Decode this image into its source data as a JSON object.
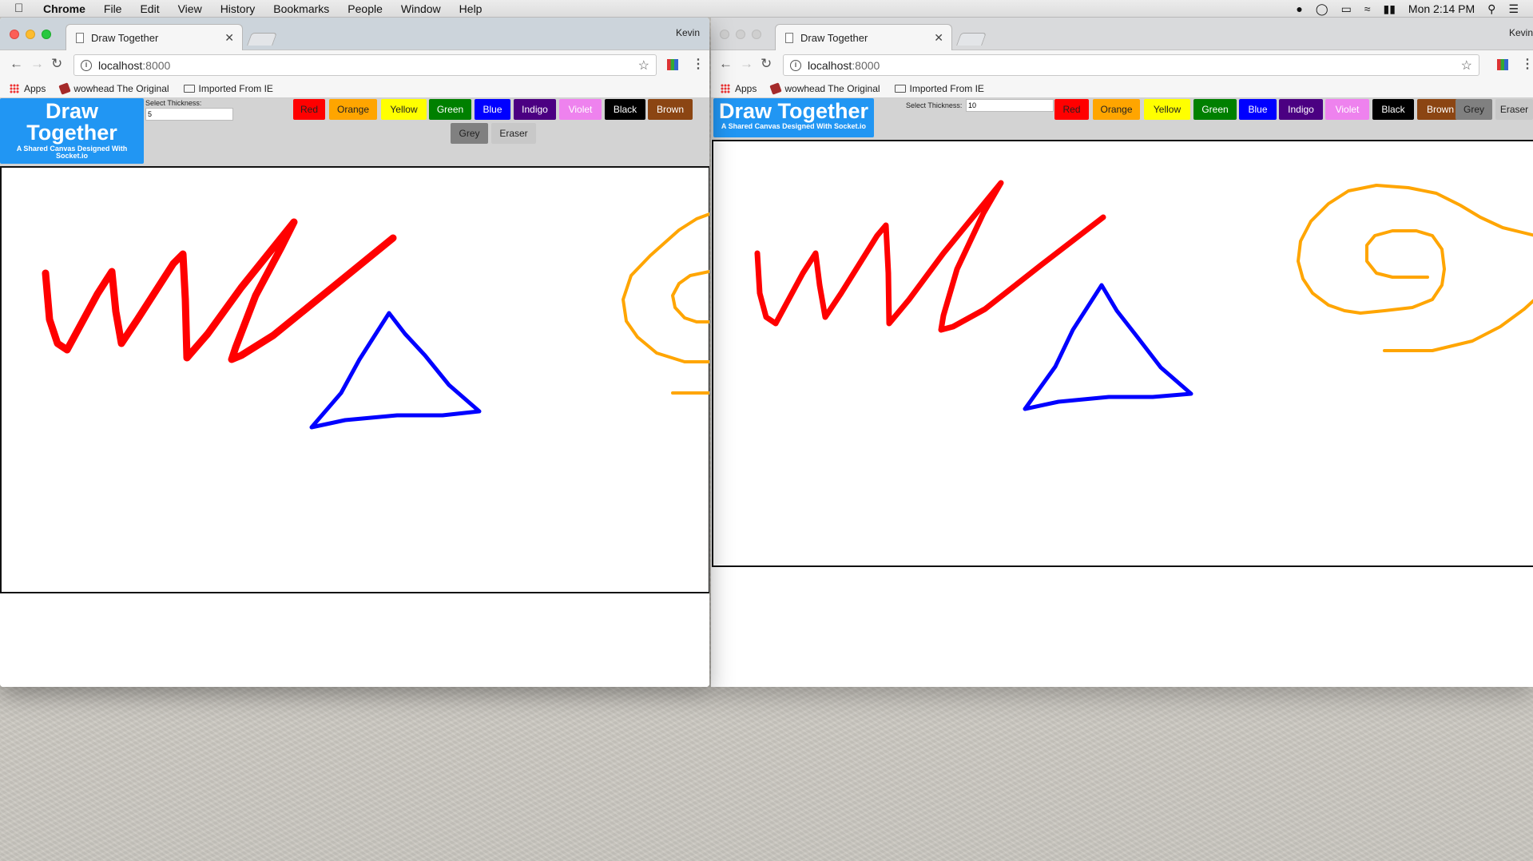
{
  "menubar": {
    "app": "Chrome",
    "items": [
      "File",
      "Edit",
      "View",
      "History",
      "Bookmarks",
      "People",
      "Window",
      "Help"
    ],
    "clock": "Mon 2:14 PM"
  },
  "browser": {
    "tab_title": "Draw Together",
    "profile": "Kevin",
    "url_host": "localhost",
    "url_port": ":8000",
    "bookmarks": [
      "Apps",
      "wowhead The Original",
      "Imported From IE"
    ]
  },
  "app": {
    "title": "Draw Together",
    "title_line1": "Draw",
    "title_line2": "Together",
    "subtitle": "A Shared Canvas Designed With Socket.io",
    "subtitle_line1": "A Shared Canvas Designed With",
    "subtitle_line2": "Socket.io",
    "thickness_label": "Select Thickness:",
    "color_buttons": [
      {
        "label": "Red",
        "bg": "#ff0000",
        "fg": "#222222"
      },
      {
        "label": "Orange",
        "bg": "#ffa500",
        "fg": "#222222"
      },
      {
        "label": "Yellow",
        "bg": "#ffff00",
        "fg": "#222222"
      },
      {
        "label": "Green",
        "bg": "#008000",
        "fg": "#ffffff"
      },
      {
        "label": "Blue",
        "bg": "#0000ff",
        "fg": "#ffffff"
      },
      {
        "label": "Indigo",
        "bg": "#4b0082",
        "fg": "#ffffff"
      },
      {
        "label": "Violet",
        "bg": "#ee82ee",
        "fg": "#ffffff"
      },
      {
        "label": "Black",
        "bg": "#000000",
        "fg": "#ffffff"
      },
      {
        "label": "Brown",
        "bg": "#8b4513",
        "fg": "#ffffff"
      },
      {
        "label": "Grey",
        "bg": "#808080",
        "fg": "#222222"
      },
      {
        "label": "Eraser",
        "bg": "#c8c8c8",
        "fg": "#222222"
      }
    ]
  },
  "windows": {
    "left": {
      "thickness_value": "5"
    },
    "right": {
      "thickness_value": "10"
    }
  },
  "colors": {
    "stroke_red": "#ff0000",
    "stroke_blue": "#0000ff",
    "stroke_orange": "#ffa500",
    "logo_blue": "#2196f3",
    "header_grey": "#d3d3d3"
  }
}
